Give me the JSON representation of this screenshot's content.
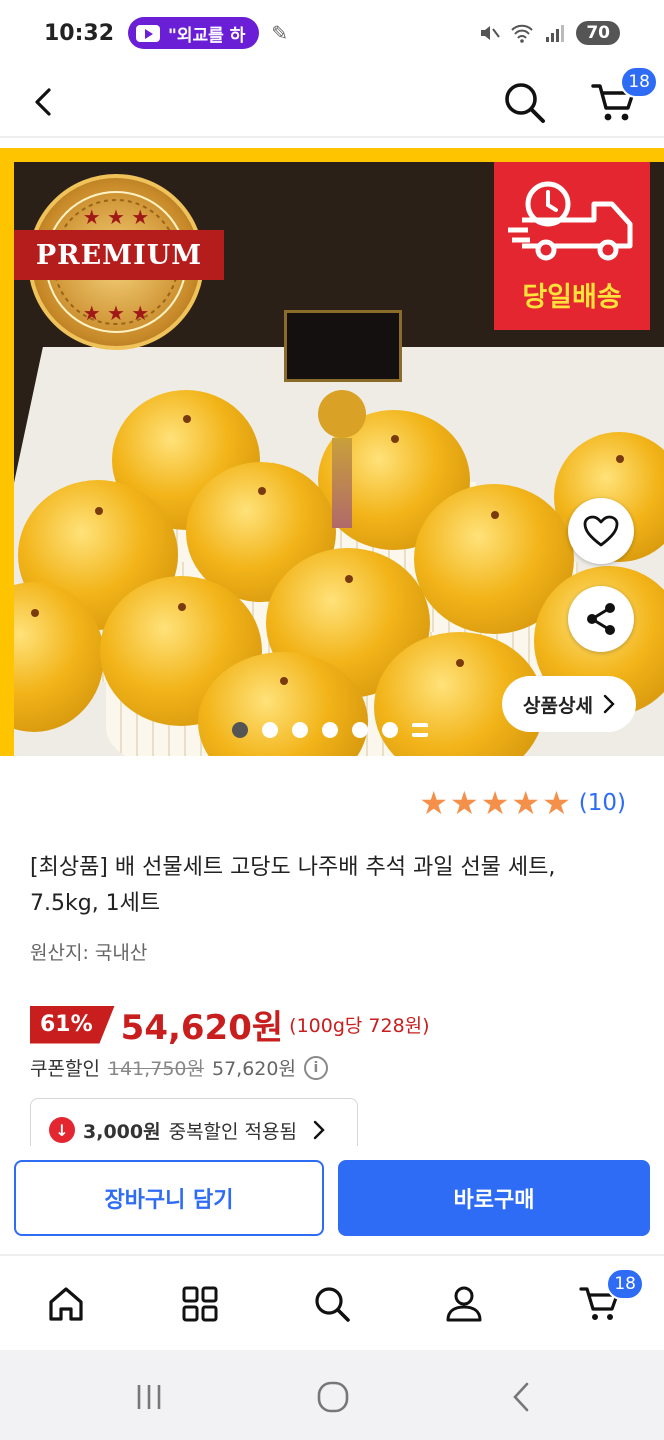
{
  "status_bar": {
    "time": "10:32",
    "notification_text": "\"외교를 하",
    "battery": "70",
    "icons": [
      "youtube-icon",
      "pen-icon",
      "mute-icon",
      "wifi-icon",
      "signal-icon"
    ]
  },
  "header": {
    "icons": [
      "back-icon",
      "search-icon",
      "cart-icon"
    ],
    "cart_count": "18"
  },
  "hero": {
    "premium_label": "PREMIUM",
    "delivery_label": "당일배송",
    "detail_button": "상품상세",
    "carousel": {
      "total_dots": 6,
      "active_index": 0
    }
  },
  "product": {
    "rating": {
      "stars": 5,
      "count": "(10)"
    },
    "title": "[최상품] 배 선물세트 고당도 나주배 추석 과일 선물 세트, 7.5kg, 1세트",
    "origin": "원산지: 국내산",
    "discount": "61%",
    "price": "54,620원",
    "unit_price": "(100g당 728원)",
    "coupon_label": "쿠폰할인",
    "original_price": "141,750원",
    "coupon_price": "57,620원",
    "extra_discount_amount": "3,000원",
    "extra_discount_text": "중복할인 적용됨"
  },
  "actions": {
    "add_to_cart": "장바구니 담기",
    "buy_now": "바로구매"
  },
  "bottom_nav": {
    "items": [
      "home-icon",
      "category-icon",
      "search-icon",
      "profile-icon",
      "cart-icon"
    ],
    "cart_count": "18"
  },
  "colors": {
    "accent": "#2f6cf5",
    "sale_red": "#c81e1e",
    "star": "#f5904a",
    "hero_border": "#ffc400"
  }
}
